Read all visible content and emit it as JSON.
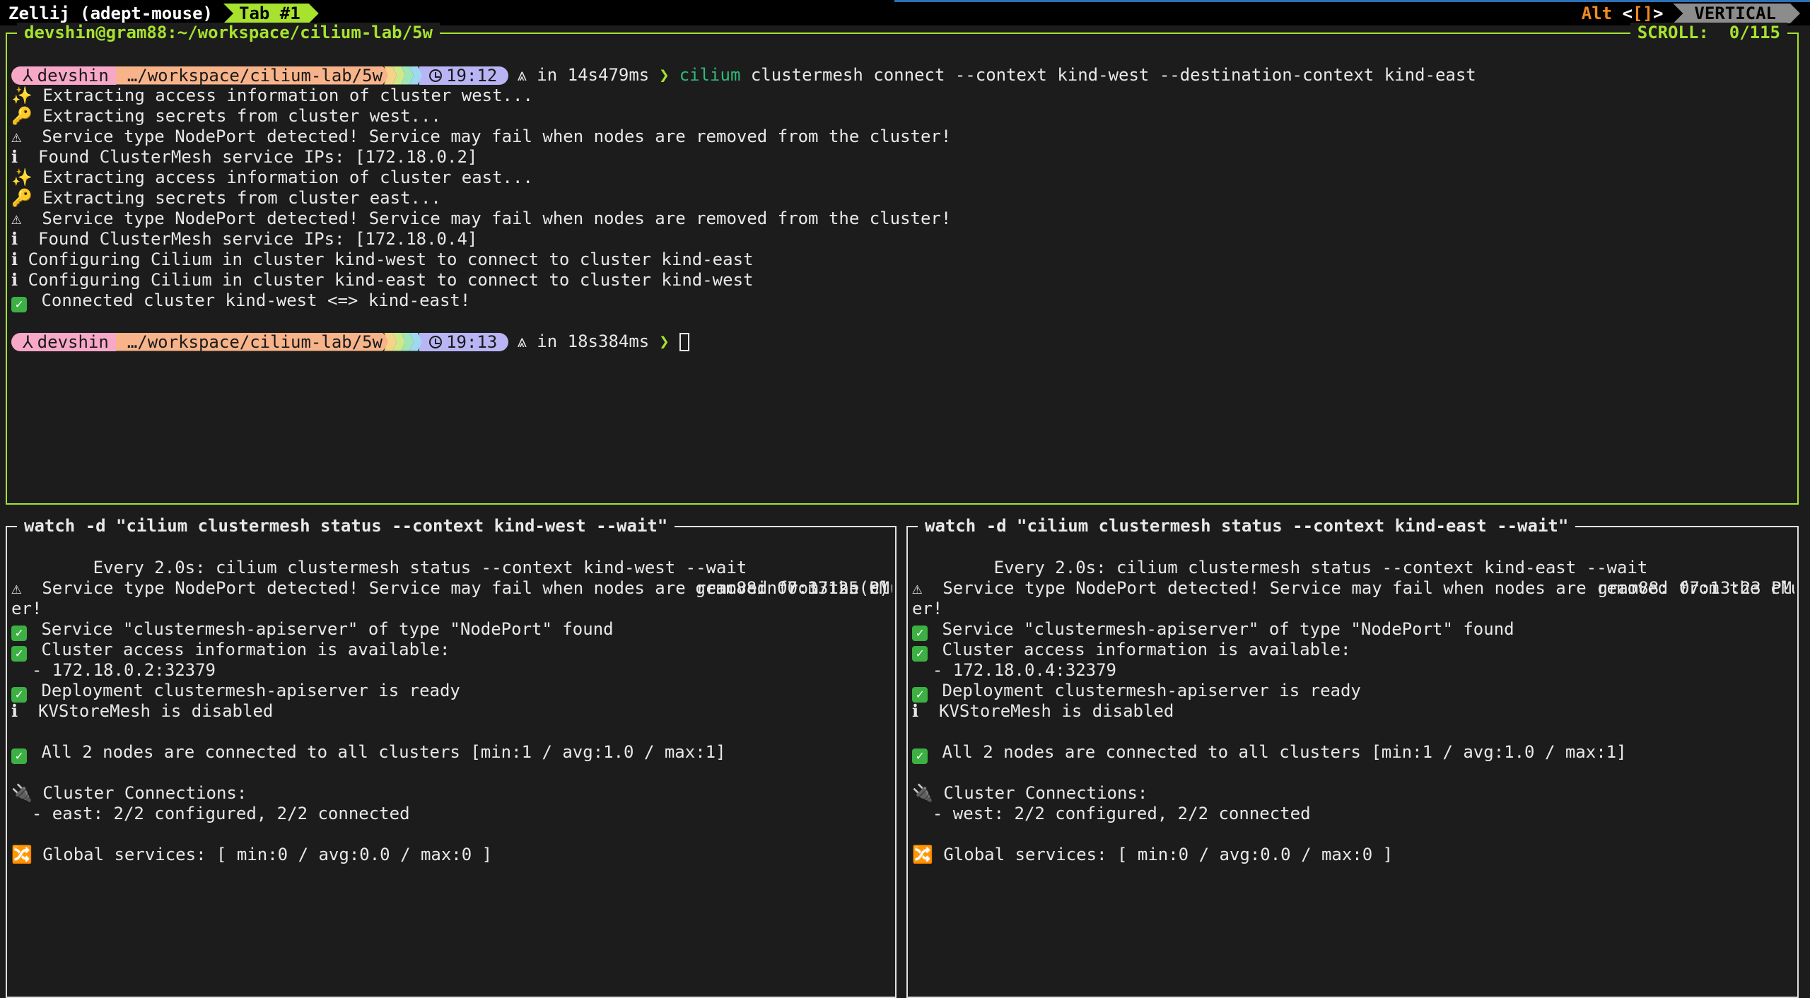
{
  "topbar": {
    "session": "Zellij (adept-mouse)",
    "tab": "Tab #1",
    "alt_label": "Alt",
    "bracket_open": "<",
    "bracket_inner": "[]",
    "bracket_close": ">",
    "mode": "VERTICAL"
  },
  "top_pane": {
    "title": "devshin@gram88:~/workspace/cilium-lab/5w",
    "scroll": "SCROLL:  0/115",
    "prompt1": {
      "user": "devshin",
      "path": "…/workspace/cilium-lab/5w",
      "time": "19:12",
      "duration": "⩓ in 14s479ms",
      "chevron": "❯",
      "cmd": "cilium",
      "args": " clustermesh connect --context kind-west --destination-context kind-east"
    },
    "lines": [
      {
        "icon": "✨",
        "text": " Extracting access information of cluster west..."
      },
      {
        "icon": "🔑",
        "text": " Extracting secrets from cluster west..."
      },
      {
        "icon": "⚠",
        "text": "  Service type NodePort detected! Service may fail when nodes are removed from the cluster!"
      },
      {
        "icon": "ℹ",
        "text": "  Found ClusterMesh service IPs: [172.18.0.2]"
      },
      {
        "icon": "✨",
        "text": " Extracting access information of cluster east..."
      },
      {
        "icon": "🔑",
        "text": " Extracting secrets from cluster east..."
      },
      {
        "icon": "⚠",
        "text": "  Service type NodePort detected! Service may fail when nodes are removed from the cluster!"
      },
      {
        "icon": "ℹ",
        "text": "  Found ClusterMesh service IPs: [172.18.0.4]"
      },
      {
        "icon": "ℹ",
        "text": " Configuring Cilium in cluster kind-west to connect to cluster kind-east"
      },
      {
        "icon": "ℹ",
        "text": " Configuring Cilium in cluster kind-east to connect to cluster kind-west"
      },
      {
        "icon": "✅",
        "text": " Connected cluster kind-west <=> kind-east!"
      }
    ],
    "prompt2": {
      "user": "devshin",
      "path": "…/workspace/cilium-lab/5w",
      "time": "19:13",
      "duration": "⩓ in 18s384ms",
      "chevron": "❯"
    }
  },
  "left_pane": {
    "title": "watch -d \"cilium clustermesh status --context kind-west --wait\"",
    "header": "Every 2.0s: cilium clustermesh status --context kind-west --wait",
    "host_time": "gram88: 07:13:25 PM",
    "duration": "in 0.371s (0)",
    "warn1": "  Service type NodePort detected! Service may fail when nodes are removed from the clust",
    "warn2": "er!",
    "svc": " Service \"clustermesh-apiserver\" of type \"NodePort\" found",
    "access": " Cluster access information is available:",
    "ip": "  - 172.18.0.2:32379",
    "deploy": " Deployment clustermesh-apiserver is ready",
    "kv": "  KVStoreMesh is disabled",
    "nodes": " All 2 nodes are connected to all clusters [min:1 / avg:1.0 / max:1]",
    "conn_title": " Cluster Connections:",
    "conn": "  - east: 2/2 configured, 2/2 connected",
    "global": " Global services: [ min:0 / avg:0.0 / max:0 ]"
  },
  "right_pane": {
    "title": "watch -d \"cilium clustermesh status --context kind-east --wait\"",
    "header": "Every 2.0s: cilium clustermesh status --context kind-east --wait",
    "host_time": "gram88: 07:13:23 PM",
    "warn1": "  Service type NodePort detected! Service may fail when nodes are removed from the clust",
    "warn2": "er!",
    "svc": " Service \"clustermesh-apiserver\" of type \"NodePort\" found",
    "access": " Cluster access information is available:",
    "ip": "  - 172.18.0.4:32379",
    "deploy": " Deployment clustermesh-apiserver is ready",
    "kv": "  KVStoreMesh is disabled",
    "nodes": " All 2 nodes are connected to all clusters [min:1 / avg:1.0 / max:1]",
    "conn_title": " Cluster Connections:",
    "conn": "  - west: 2/2 configured, 2/2 connected",
    "global": " Global services: [ min:0 / avg:0.0 / max:0 ]"
  },
  "colors": {
    "accent": "#a6e22e",
    "alt": "#f08a24",
    "user_seg": "#f7a8c6",
    "path_seg": "#f7b38a",
    "time_seg": "#b9b4f4",
    "arrows": [
      "#f7d38a",
      "#cfe88a",
      "#9ee6b8",
      "#9fd8f0"
    ]
  }
}
